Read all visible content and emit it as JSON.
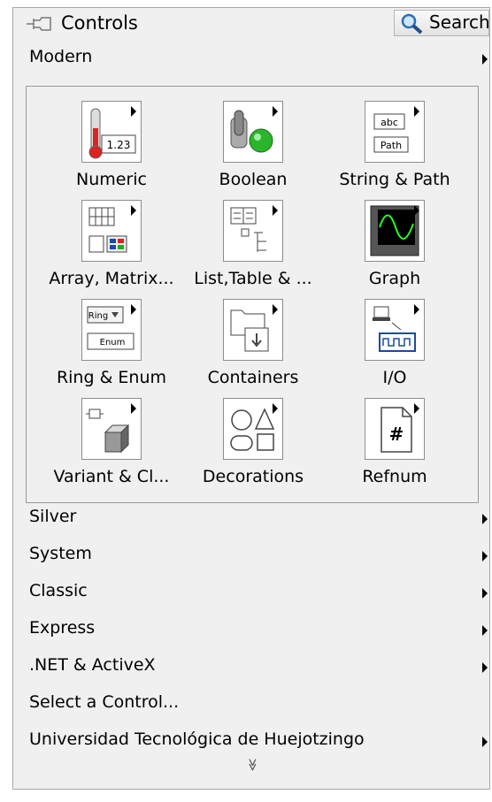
{
  "palette": {
    "title": "Controls",
    "search_label": "Search",
    "modern_label": "Modern",
    "tiles": [
      {
        "label": "Numeric",
        "icon_text": "1.23"
      },
      {
        "label": "Boolean"
      },
      {
        "label": "String & Path",
        "icon_text_1": "abc",
        "icon_text_2": "Path"
      },
      {
        "label": "Array, Matrix..."
      },
      {
        "label": "List,Table & ..."
      },
      {
        "label": "Graph"
      },
      {
        "label": "Ring & Enum",
        "icon_text_1": "Ring",
        "icon_text_2": "Enum"
      },
      {
        "label": "Containers"
      },
      {
        "label": "I/O"
      },
      {
        "label": "Variant & Cl..."
      },
      {
        "label": "Decorations"
      },
      {
        "label": "Refnum",
        "icon_text": "#"
      }
    ],
    "categories": [
      {
        "label": "Silver"
      },
      {
        "label": "System"
      },
      {
        "label": "Classic"
      },
      {
        "label": "Express"
      },
      {
        "label": ".NET & ActiveX"
      },
      {
        "label": "Select a Control..."
      },
      {
        "label": "Universidad Tecnológica de Huejotzingo"
      }
    ],
    "more_glyph": "≫"
  }
}
